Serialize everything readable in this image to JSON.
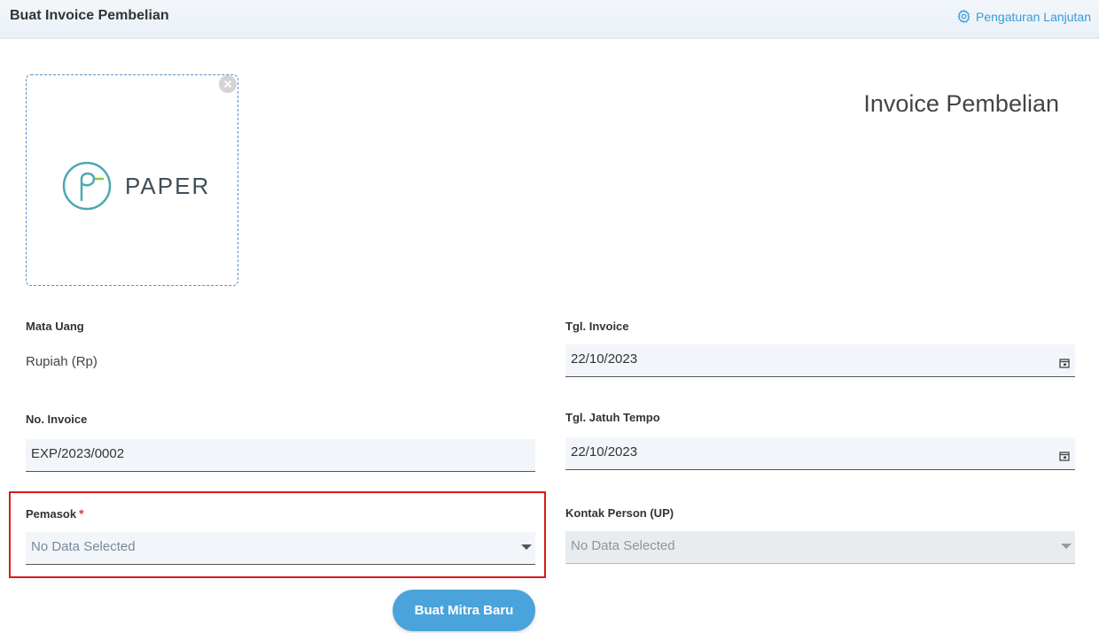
{
  "header": {
    "title": "Buat Invoice Pembelian",
    "advanced_settings": "Pengaturan Lanjutan"
  },
  "logo": {
    "text": "PAPER"
  },
  "document_title": "Invoice Pembelian",
  "form": {
    "currency": {
      "label": "Mata Uang",
      "value": "Rupiah (Rp)"
    },
    "invoice_date": {
      "label": "Tgl. Invoice",
      "value": "22/10/2023"
    },
    "invoice_no": {
      "label": "No. Invoice",
      "value": "EXP/2023/0002"
    },
    "due_date": {
      "label": "Tgl. Jatuh Tempo",
      "value": "22/10/2023"
    },
    "supplier": {
      "label": "Pemasok",
      "required_mark": "*",
      "placeholder": "No Data Selected"
    },
    "contact": {
      "label": "Kontak Person (UP)",
      "placeholder": "No Data Selected"
    }
  },
  "buttons": {
    "create_partner": "Buat Mitra Baru"
  },
  "colors": {
    "accent": "#4aa3db",
    "highlight": "#d9181b",
    "required": "#e53935"
  }
}
